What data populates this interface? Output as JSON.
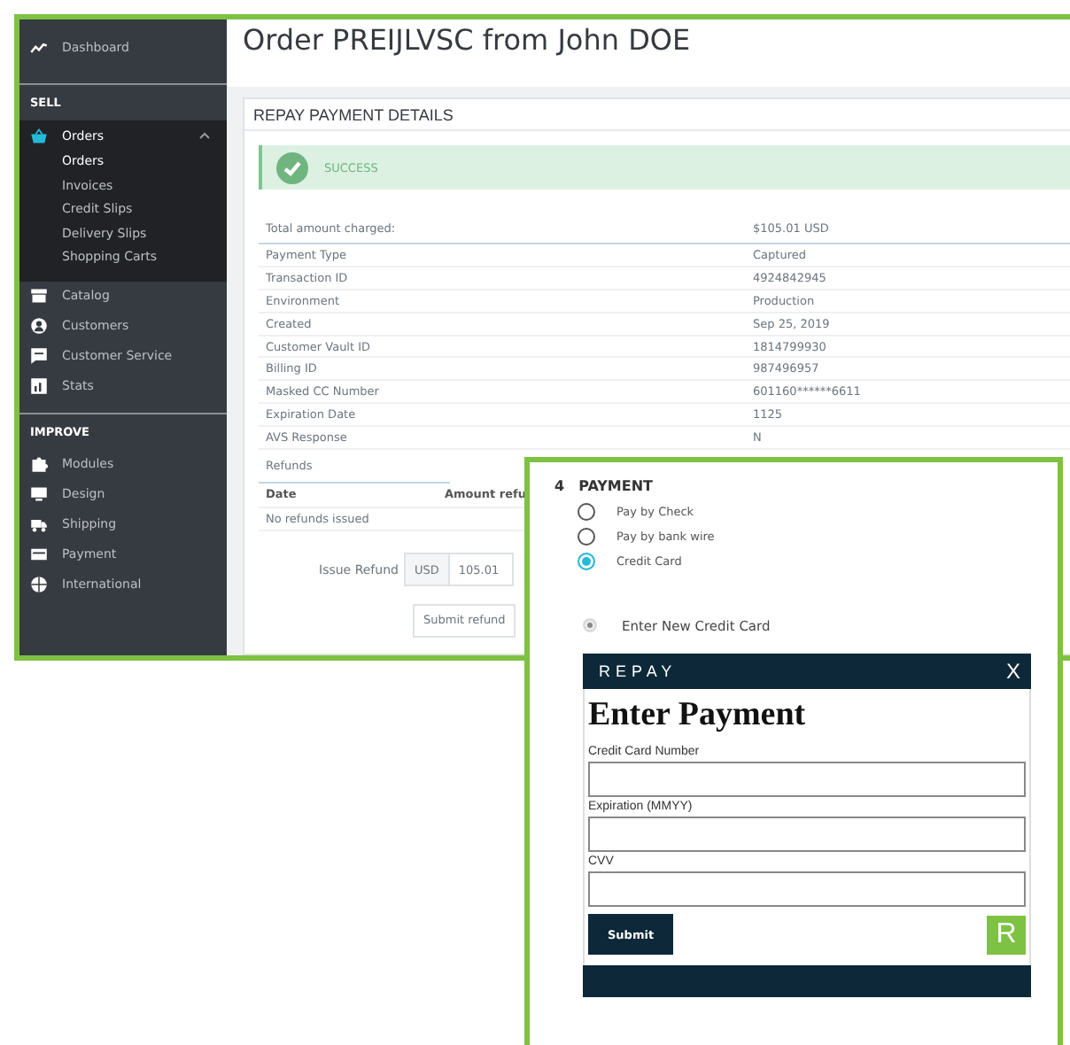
{
  "admin": {
    "sidebar": {
      "top": [
        {
          "label": "Dashboard",
          "selected": false
        }
      ],
      "sections": [
        {
          "heading": "SELL",
          "items": [
            {
              "label": "Orders",
              "selected": true,
              "expanded": true,
              "children": [
                {
                  "label": "Orders",
                  "selected": true
                },
                {
                  "label": "Invoices",
                  "selected": false
                },
                {
                  "label": "Credit Slips",
                  "selected": false
                },
                {
                  "label": "Delivery Slips",
                  "selected": false
                },
                {
                  "label": "Shopping Carts",
                  "selected": false
                }
              ]
            },
            {
              "label": "Catalog",
              "selected": false
            },
            {
              "label": "Customers",
              "selected": false
            },
            {
              "label": "Customer Service",
              "selected": false
            },
            {
              "label": "Stats",
              "selected": false
            }
          ]
        },
        {
          "heading": "IMPROVE",
          "items": [
            {
              "label": "Modules",
              "selected": false
            },
            {
              "label": "Design",
              "selected": false
            },
            {
              "label": "Shipping",
              "selected": false
            },
            {
              "label": "Payment",
              "selected": false
            },
            {
              "label": "International",
              "selected": false
            }
          ]
        }
      ]
    },
    "title": "Order PREIJLVSC from John DOE",
    "panel": {
      "title": "REPAY PAYMENT DETAILS",
      "alert": {
        "text": "SUCCESS"
      },
      "total": {
        "label": "Total amount charged:",
        "value": "$105.01 USD"
      },
      "rows": [
        {
          "label": "Payment Type",
          "value": "Captured"
        },
        {
          "label": "Transaction ID",
          "value": "4924842945"
        },
        {
          "label": "Environment",
          "value": "Production"
        },
        {
          "label": "Created",
          "value": "Sep 25, 2019"
        },
        {
          "label": "Customer Vault ID",
          "value": "1814799930"
        },
        {
          "label": "Billing ID",
          "value": "987496957"
        },
        {
          "label": "Masked CC Number",
          "value": "601160******6611"
        },
        {
          "label": "Expiration Date",
          "value": "1125"
        },
        {
          "label": "AVS Response",
          "value": "N"
        }
      ],
      "refunds": {
        "heading": "Refunds",
        "columns": [
          "Date",
          "Amount refu"
        ],
        "empty_message": "No refunds issued"
      },
      "issue_refund": {
        "label": "Issue Refund",
        "currency": "USD",
        "value": "105.01",
        "button": "Submit refund"
      }
    }
  },
  "checkout": {
    "step": "4",
    "title": "PAYMENT",
    "options": [
      {
        "label": "Pay by Check",
        "selected": false
      },
      {
        "label": "Pay by bank wire",
        "selected": false
      },
      {
        "label": "Credit Card",
        "selected": true
      }
    ],
    "card_option": {
      "label": "Enter New Credit Card",
      "selected": true
    },
    "widget": {
      "logo": "REPAY",
      "close": "X",
      "title": "Enter Payment",
      "fields": [
        {
          "label": "Credit Card Number"
        },
        {
          "label": "Expiration (MMYY)"
        },
        {
          "label": "CVV"
        }
      ],
      "submit": "Submit",
      "badge": "R"
    }
  }
}
